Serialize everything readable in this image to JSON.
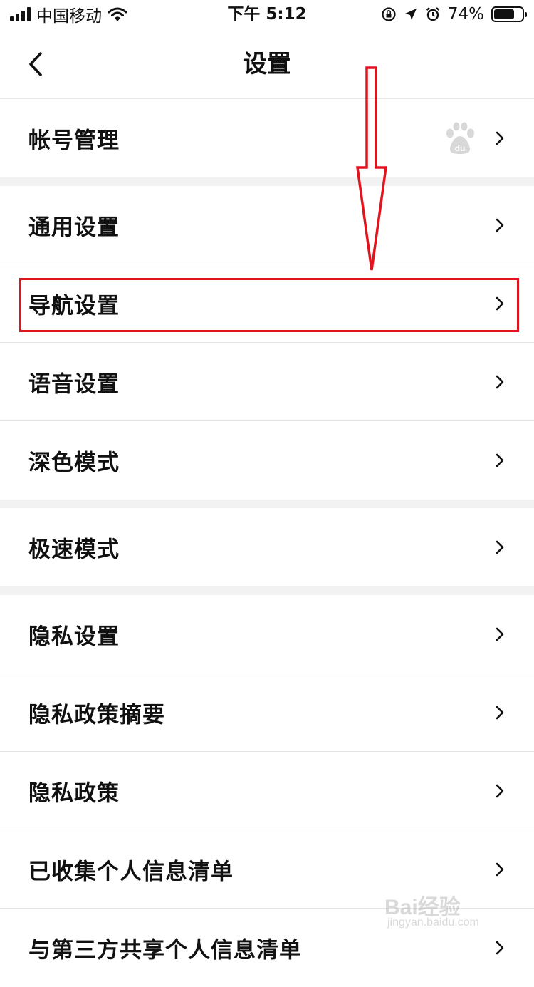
{
  "status_bar": {
    "carrier": "中国移动",
    "time": "下午 5:12",
    "battery_percent": "74%",
    "battery_level": 0.74,
    "icons": [
      "signal-icon",
      "wifi-icon",
      "orientation-lock-icon",
      "location-arrow-icon",
      "alarm-icon",
      "battery-icon"
    ]
  },
  "navbar": {
    "title": "设置",
    "back_icon": "chevron-left-icon"
  },
  "settings": {
    "groups": [
      {
        "items": [
          {
            "label": "帐号管理",
            "trailing_icon": "baidu-paw-icon"
          }
        ]
      },
      {
        "items": [
          {
            "label": "通用设置"
          },
          {
            "label": "导航设置",
            "highlighted": true
          },
          {
            "label": "语音设置"
          },
          {
            "label": "深色模式"
          }
        ]
      },
      {
        "items": [
          {
            "label": "极速模式"
          }
        ]
      },
      {
        "items": [
          {
            "label": "隐私设置"
          },
          {
            "label": "隐私政策摘要"
          },
          {
            "label": "隐私政策"
          },
          {
            "label": "已收集个人信息清单"
          },
          {
            "label": "与第三方共享个人信息清单"
          }
        ]
      }
    ]
  },
  "annotation": {
    "color": "#e3131e",
    "arrow_points_to": "导航设置"
  },
  "watermark": {
    "main": "Bai经验",
    "sub": "jingyan.baidu.com"
  },
  "colors": {
    "background": "#f2f2f2",
    "row_background": "#ffffff",
    "text": "#111111",
    "highlight_red": "#e3131e"
  }
}
